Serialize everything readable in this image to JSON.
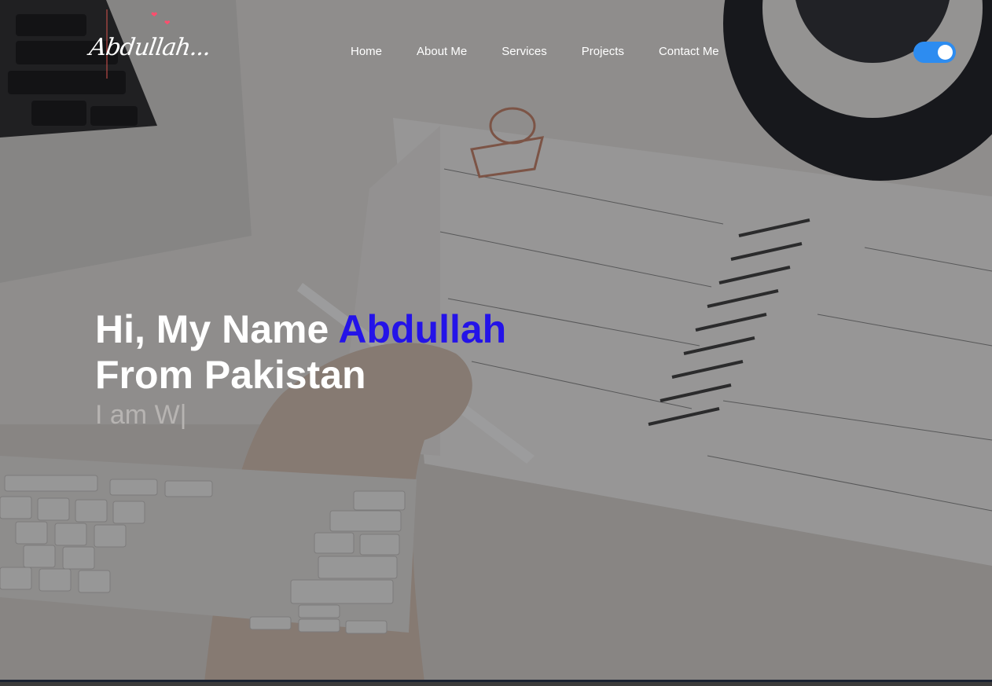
{
  "header": {
    "logo_text": "Abdullah...",
    "nav": [
      "Home",
      "About Me",
      "Services",
      "Projects",
      "Contact Me"
    ],
    "theme_toggle": {
      "state": "on",
      "color": "#2d8cf0"
    }
  },
  "hero": {
    "line1_prefix": "Hi, My Name ",
    "name": "Abdullah",
    "line2": "From Pakistan",
    "typed_text": "I am W|",
    "accent_color": "#2413e8"
  },
  "icons": [
    "heart-icon",
    "heart-icon"
  ]
}
